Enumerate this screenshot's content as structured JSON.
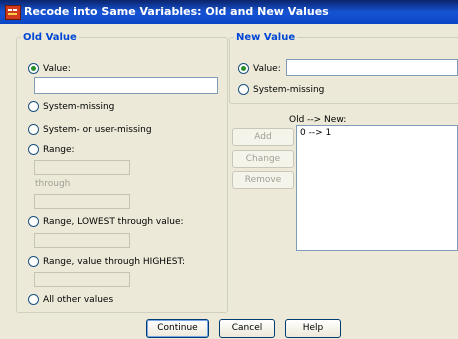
{
  "window": {
    "title": "Recode into Same Variables: Old and New Values"
  },
  "old_value": {
    "legend": "Old Value",
    "value_label": "Value:",
    "value_input": "",
    "system_missing": "System-missing",
    "system_or_user_missing": "System- or user-missing",
    "range": "Range:",
    "through": "through",
    "range_lowest": "Range, LOWEST through value:",
    "range_highest": "Range, value through HIGHEST:",
    "all_other": "All other values",
    "selected": "value"
  },
  "new_value": {
    "legend": "New Value",
    "value_label": "Value:",
    "value_input": "",
    "system_missing": "System-missing",
    "selected": "value"
  },
  "mapping": {
    "header": "Old --> New:",
    "items": [
      "0 --> 1"
    ],
    "add": "Add",
    "change": "Change",
    "remove": "Remove"
  },
  "footer": {
    "continue": "Continue",
    "cancel": "Cancel",
    "help": "Help"
  }
}
